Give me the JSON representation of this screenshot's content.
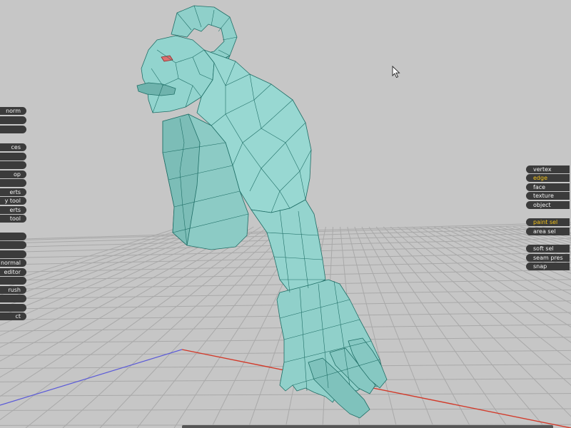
{
  "colors": {
    "background": "#c6c6c6",
    "grid_line": "#a6a6a6",
    "x_axis": "#d23a2a",
    "z_axis": "#5a5ad8",
    "mesh_fill": "#8ecfc9",
    "mesh_wire": "#1f6e66",
    "tool_bg": "#3b3b3b",
    "tool_text": "#f2f2f2",
    "tool_active": "#f2c21a"
  },
  "left_toolbar": {
    "items": [
      {
        "label": "norm"
      },
      {
        "label": ""
      },
      {
        "label": ""
      },
      {
        "label": "ces"
      },
      {
        "label": ""
      },
      {
        "label": ""
      },
      {
        "label": "op"
      },
      {
        "label": ""
      },
      {
        "label": "erts"
      },
      {
        "label": "y tool"
      },
      {
        "label": "erts"
      },
      {
        "label": "tool"
      },
      {
        "label": ""
      },
      {
        "label": ""
      },
      {
        "label": ""
      },
      {
        "label": "g normal"
      },
      {
        "label": "editor"
      },
      {
        "label": ""
      },
      {
        "label": "rush"
      },
      {
        "label": ""
      },
      {
        "label": ""
      },
      {
        "label": "ct"
      }
    ]
  },
  "right_toolbar": {
    "selection_modes": [
      {
        "label": "vertex",
        "active": false
      },
      {
        "label": "edge",
        "active": true
      },
      {
        "label": "face",
        "active": false
      },
      {
        "label": "texture",
        "active": false
      },
      {
        "label": "object",
        "active": false
      }
    ],
    "select_tools": [
      {
        "label": "paint sel",
        "active": true
      },
      {
        "label": "area sel",
        "active": false
      }
    ],
    "options": [
      {
        "label": "soft sel",
        "active": false
      },
      {
        "label": "seam pres",
        "active": false
      },
      {
        "label": "snap",
        "active": false
      }
    ]
  }
}
